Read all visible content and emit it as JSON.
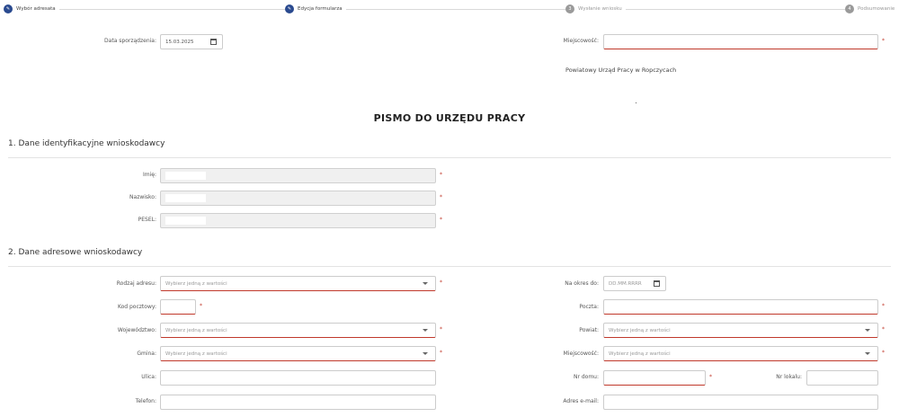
{
  "stepper": {
    "steps": [
      {
        "label": "Wybór adresata",
        "status": "done",
        "icon": "pencil-icon"
      },
      {
        "label": "Edycja formularza",
        "status": "done",
        "icon": "pencil-icon"
      },
      {
        "label": "Wysłanie wniosku",
        "status": "todo",
        "number": "3"
      },
      {
        "label": "Podsumowanie",
        "status": "todo",
        "number": "4"
      }
    ]
  },
  "header": {
    "date_label": "Data sporządzenia:",
    "date_value": "15.03.2025",
    "place_label": "Miejscowość:",
    "office_name": "Powiatowy Urząd Pracy w Ropczycach"
  },
  "title": "PISMO DO URZĘDU PRACY",
  "section1": {
    "title": "1. Dane identyfikacyjne wnioskodawcy",
    "first_name_label": "Imię:",
    "last_name_label": "Nazwisko:",
    "pesel_label": "PESEL:"
  },
  "section2": {
    "title": "2. Dane adresowe wnioskodawcy",
    "address_type_label": "Rodzaj adresu:",
    "address_type_placeholder": "Wybierz jedną z wartości",
    "valid_until_label": "Na okres do:",
    "valid_until_placeholder": "DD.MM.RRRR",
    "postal_code_label": "Kod pocztowy:",
    "post_office_label": "Poczta:",
    "voivodeship_label": "Województwo:",
    "voivodeship_placeholder": "Wybierz jedną z wartości",
    "county_label": "Powiat:",
    "county_placeholder": "Wybierz jedną z wartości",
    "commune_label": "Gmina:",
    "commune_placeholder": "Wybierz jedną z wartości",
    "locality_label": "Miejscowość:",
    "locality_placeholder": "Wybierz jedną z wartości",
    "street_label": "Ulica:",
    "house_no_label": "Nr domu:",
    "flat_no_label": "Nr lokalu:",
    "phone_label": "Telefon:",
    "email_label": "Adres e-mail:"
  },
  "required_mark": "*"
}
